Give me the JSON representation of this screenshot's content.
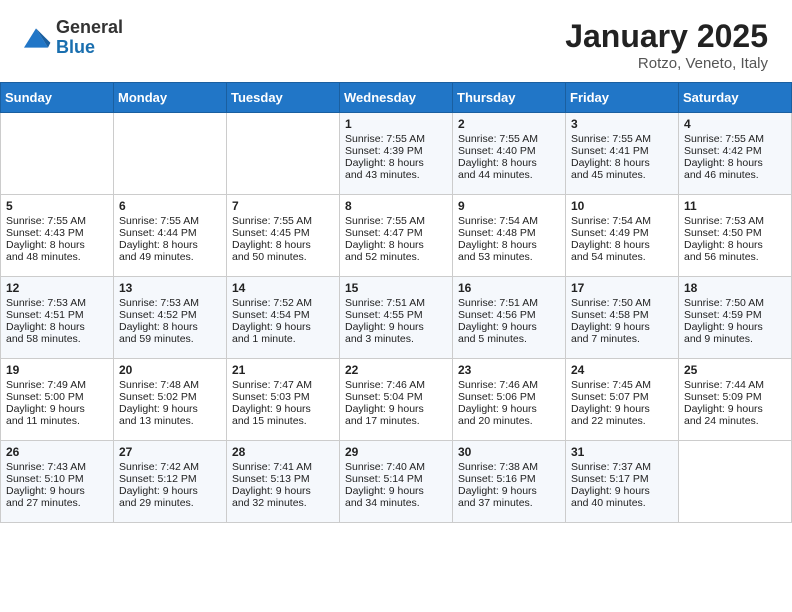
{
  "logo": {
    "general": "General",
    "blue": "Blue"
  },
  "title": "January 2025",
  "location": "Rotzo, Veneto, Italy",
  "weekdays": [
    "Sunday",
    "Monday",
    "Tuesday",
    "Wednesday",
    "Thursday",
    "Friday",
    "Saturday"
  ],
  "weeks": [
    [
      {
        "day": "",
        "content": ""
      },
      {
        "day": "",
        "content": ""
      },
      {
        "day": "",
        "content": ""
      },
      {
        "day": "1",
        "content": "Sunrise: 7:55 AM\nSunset: 4:39 PM\nDaylight: 8 hours\nand 43 minutes."
      },
      {
        "day": "2",
        "content": "Sunrise: 7:55 AM\nSunset: 4:40 PM\nDaylight: 8 hours\nand 44 minutes."
      },
      {
        "day": "3",
        "content": "Sunrise: 7:55 AM\nSunset: 4:41 PM\nDaylight: 8 hours\nand 45 minutes."
      },
      {
        "day": "4",
        "content": "Sunrise: 7:55 AM\nSunset: 4:42 PM\nDaylight: 8 hours\nand 46 minutes."
      }
    ],
    [
      {
        "day": "5",
        "content": "Sunrise: 7:55 AM\nSunset: 4:43 PM\nDaylight: 8 hours\nand 48 minutes."
      },
      {
        "day": "6",
        "content": "Sunrise: 7:55 AM\nSunset: 4:44 PM\nDaylight: 8 hours\nand 49 minutes."
      },
      {
        "day": "7",
        "content": "Sunrise: 7:55 AM\nSunset: 4:45 PM\nDaylight: 8 hours\nand 50 minutes."
      },
      {
        "day": "8",
        "content": "Sunrise: 7:55 AM\nSunset: 4:47 PM\nDaylight: 8 hours\nand 52 minutes."
      },
      {
        "day": "9",
        "content": "Sunrise: 7:54 AM\nSunset: 4:48 PM\nDaylight: 8 hours\nand 53 minutes."
      },
      {
        "day": "10",
        "content": "Sunrise: 7:54 AM\nSunset: 4:49 PM\nDaylight: 8 hours\nand 54 minutes."
      },
      {
        "day": "11",
        "content": "Sunrise: 7:53 AM\nSunset: 4:50 PM\nDaylight: 8 hours\nand 56 minutes."
      }
    ],
    [
      {
        "day": "12",
        "content": "Sunrise: 7:53 AM\nSunset: 4:51 PM\nDaylight: 8 hours\nand 58 minutes."
      },
      {
        "day": "13",
        "content": "Sunrise: 7:53 AM\nSunset: 4:52 PM\nDaylight: 8 hours\nand 59 minutes."
      },
      {
        "day": "14",
        "content": "Sunrise: 7:52 AM\nSunset: 4:54 PM\nDaylight: 9 hours\nand 1 minute."
      },
      {
        "day": "15",
        "content": "Sunrise: 7:51 AM\nSunset: 4:55 PM\nDaylight: 9 hours\nand 3 minutes."
      },
      {
        "day": "16",
        "content": "Sunrise: 7:51 AM\nSunset: 4:56 PM\nDaylight: 9 hours\nand 5 minutes."
      },
      {
        "day": "17",
        "content": "Sunrise: 7:50 AM\nSunset: 4:58 PM\nDaylight: 9 hours\nand 7 minutes."
      },
      {
        "day": "18",
        "content": "Sunrise: 7:50 AM\nSunset: 4:59 PM\nDaylight: 9 hours\nand 9 minutes."
      }
    ],
    [
      {
        "day": "19",
        "content": "Sunrise: 7:49 AM\nSunset: 5:00 PM\nDaylight: 9 hours\nand 11 minutes."
      },
      {
        "day": "20",
        "content": "Sunrise: 7:48 AM\nSunset: 5:02 PM\nDaylight: 9 hours\nand 13 minutes."
      },
      {
        "day": "21",
        "content": "Sunrise: 7:47 AM\nSunset: 5:03 PM\nDaylight: 9 hours\nand 15 minutes."
      },
      {
        "day": "22",
        "content": "Sunrise: 7:46 AM\nSunset: 5:04 PM\nDaylight: 9 hours\nand 17 minutes."
      },
      {
        "day": "23",
        "content": "Sunrise: 7:46 AM\nSunset: 5:06 PM\nDaylight: 9 hours\nand 20 minutes."
      },
      {
        "day": "24",
        "content": "Sunrise: 7:45 AM\nSunset: 5:07 PM\nDaylight: 9 hours\nand 22 minutes."
      },
      {
        "day": "25",
        "content": "Sunrise: 7:44 AM\nSunset: 5:09 PM\nDaylight: 9 hours\nand 24 minutes."
      }
    ],
    [
      {
        "day": "26",
        "content": "Sunrise: 7:43 AM\nSunset: 5:10 PM\nDaylight: 9 hours\nand 27 minutes."
      },
      {
        "day": "27",
        "content": "Sunrise: 7:42 AM\nSunset: 5:12 PM\nDaylight: 9 hours\nand 29 minutes."
      },
      {
        "day": "28",
        "content": "Sunrise: 7:41 AM\nSunset: 5:13 PM\nDaylight: 9 hours\nand 32 minutes."
      },
      {
        "day": "29",
        "content": "Sunrise: 7:40 AM\nSunset: 5:14 PM\nDaylight: 9 hours\nand 34 minutes."
      },
      {
        "day": "30",
        "content": "Sunrise: 7:38 AM\nSunset: 5:16 PM\nDaylight: 9 hours\nand 37 minutes."
      },
      {
        "day": "31",
        "content": "Sunrise: 7:37 AM\nSunset: 5:17 PM\nDaylight: 9 hours\nand 40 minutes."
      },
      {
        "day": "",
        "content": ""
      }
    ]
  ]
}
